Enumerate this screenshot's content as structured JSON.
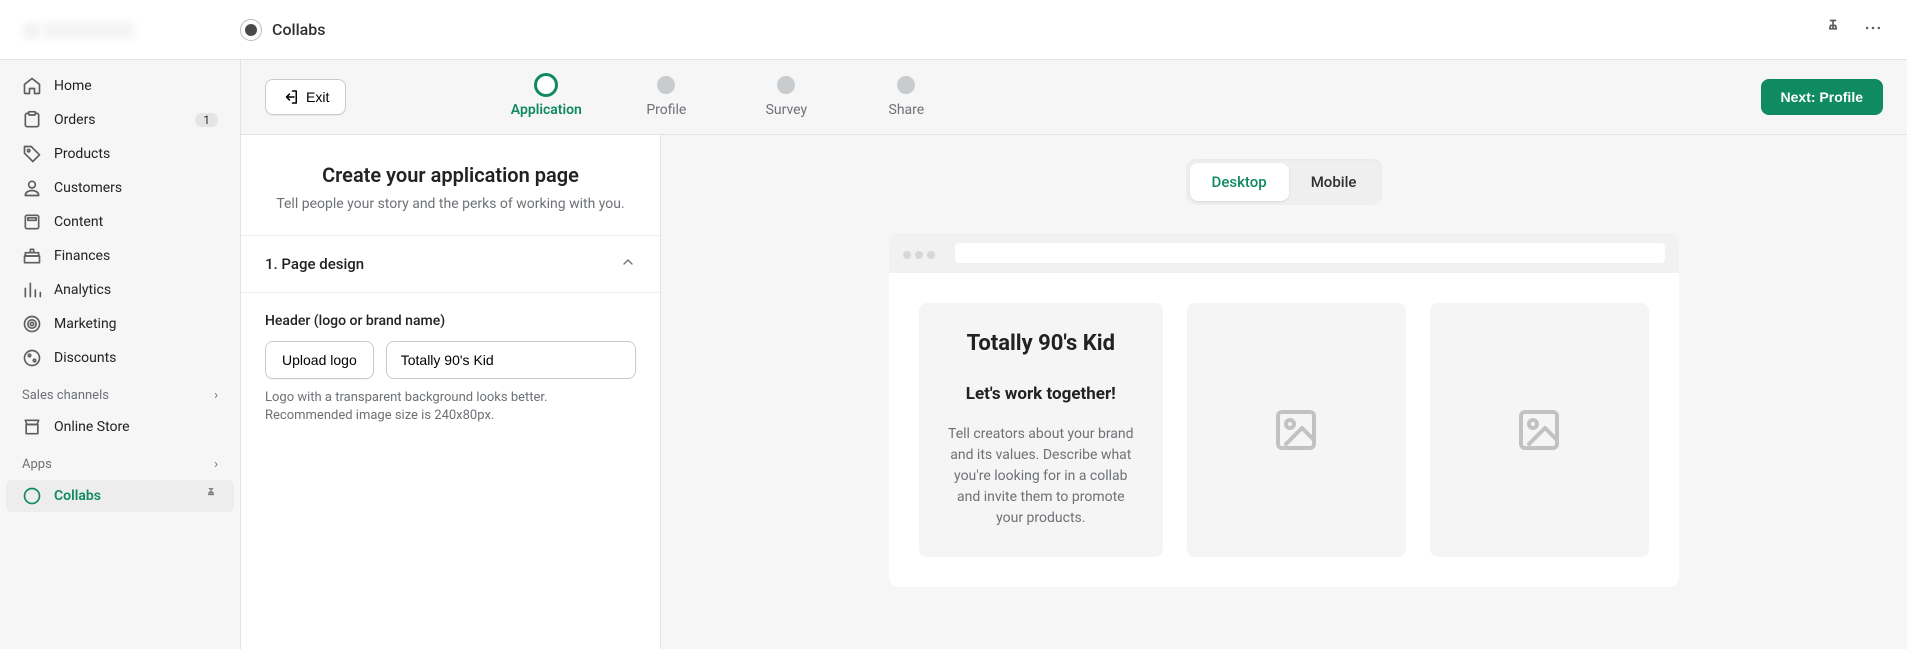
{
  "topbar": {
    "app_name": "Collabs"
  },
  "sidebar": {
    "items": [
      {
        "label": "Home"
      },
      {
        "label": "Orders",
        "badge": "1"
      },
      {
        "label": "Products"
      },
      {
        "label": "Customers"
      },
      {
        "label": "Content"
      },
      {
        "label": "Finances"
      },
      {
        "label": "Analytics"
      },
      {
        "label": "Marketing"
      },
      {
        "label": "Discounts"
      }
    ],
    "sales_channels_label": "Sales channels",
    "online_store_label": "Online Store",
    "apps_label": "Apps",
    "collabs_label": "Collabs"
  },
  "toolbar": {
    "exit": "Exit",
    "next": "Next: Profile",
    "steps": [
      "Application",
      "Profile",
      "Survey",
      "Share"
    ]
  },
  "page_header": {
    "title": "Create your application page",
    "subtitle": "Tell people your story and the perks of working with you."
  },
  "accordion": {
    "label": "1. Page design"
  },
  "form": {
    "header_label": "Header (logo or brand name)",
    "upload": "Upload logo",
    "brand_value": "Totally 90's Kid",
    "hint": "Logo with a transparent background looks better. Recommended image size is 240x80px."
  },
  "view_toggle": {
    "desktop": "Desktop",
    "mobile": "Mobile"
  },
  "preview": {
    "brand": "Totally 90's Kid",
    "headline": "Let's work together!",
    "body": "Tell creators about your brand and its values. Describe what you're looking for in a collab and invite them to promote your products."
  }
}
